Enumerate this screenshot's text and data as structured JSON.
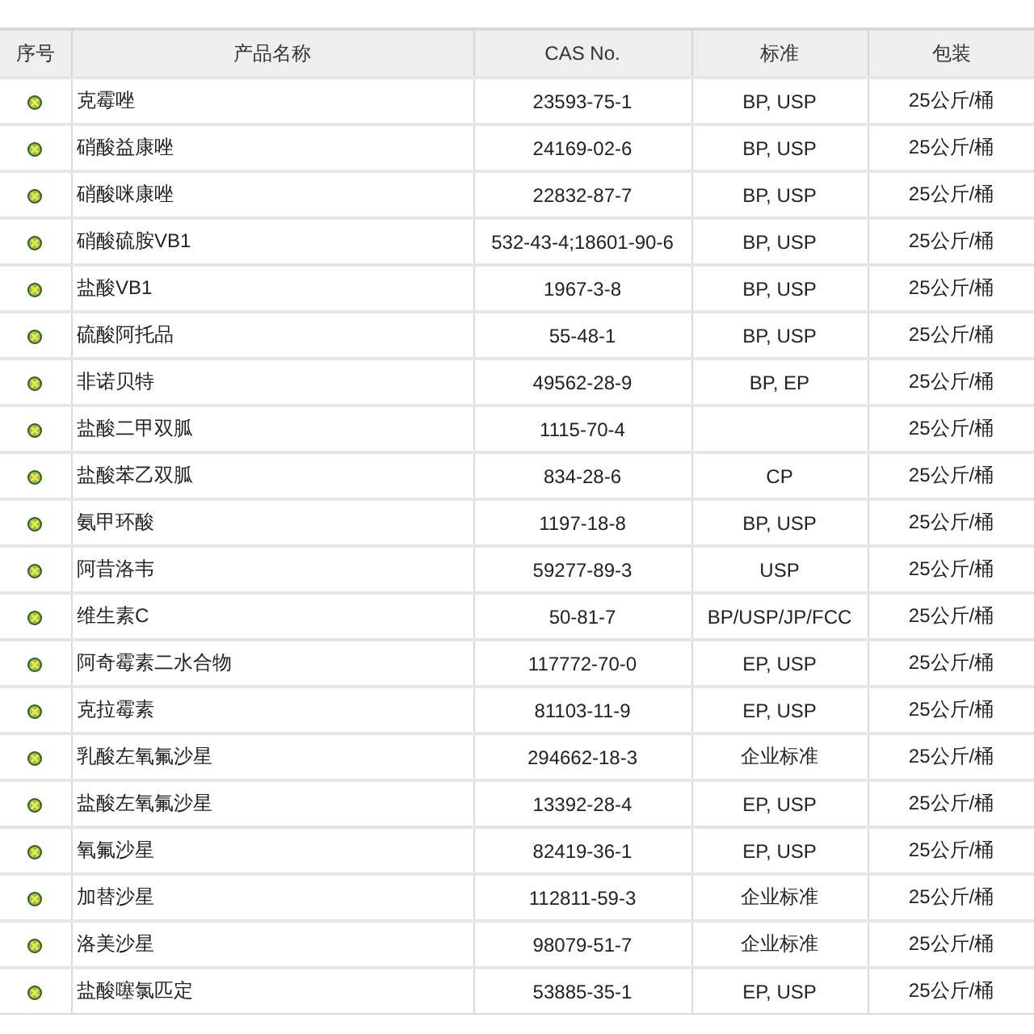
{
  "table": {
    "columns": [
      "序号",
      "产品名称",
      "CAS No.",
      "标准",
      "包装"
    ],
    "rows": [
      {
        "name": "克霉唑",
        "cas": "23593-75-1",
        "standard": "BP, USP",
        "packing": "25公斤/桶"
      },
      {
        "name": "硝酸益康唑",
        "cas": "24169-02-6",
        "standard": "BP, USP",
        "packing": "25公斤/桶"
      },
      {
        "name": "硝酸咪康唑",
        "cas": "22832-87-7",
        "standard": "BP, USP",
        "packing": "25公斤/桶"
      },
      {
        "name": "硝酸硫胺VB1",
        "cas": "532-43-4;18601-90-6",
        "standard": "BP, USP",
        "packing": "25公斤/桶"
      },
      {
        "name": "盐酸VB1",
        "cas": "1967-3-8",
        "standard": "BP, USP",
        "packing": "25公斤/桶"
      },
      {
        "name": "硫酸阿托品",
        "cas": "55-48-1",
        "standard": "BP, USP",
        "packing": "25公斤/桶"
      },
      {
        "name": "非诺贝特",
        "cas": "49562-28-9",
        "standard": "BP, EP",
        "packing": "25公斤/桶"
      },
      {
        "name": "盐酸二甲双胍",
        "cas": "1115-70-4",
        "packing": "25公斤/桶"
      },
      {
        "name": "盐酸苯乙双胍",
        "cas": "834-28-6",
        "standard": "CP",
        "packing": "25公斤/桶"
      },
      {
        "name": "氨甲环酸",
        "cas": "1197-18-8",
        "standard": "BP, USP",
        "packing": "25公斤/桶"
      },
      {
        "name": "阿昔洛韦",
        "cas": "59277-89-3",
        "standard": "USP",
        "packing": "25公斤/桶"
      },
      {
        "name": "维生素C",
        "cas": "50-81-7",
        "standard": "BP/USP/JP/FCC",
        "packing": "25公斤/桶"
      },
      {
        "name": "阿奇霉素二水合物",
        "cas": "117772-70-0",
        "standard": "EP, USP",
        "packing": "25公斤/桶"
      },
      {
        "name": "克拉霉素",
        "cas": "81103-11-9",
        "standard": "EP, USP",
        "packing": "25公斤/桶"
      },
      {
        "name": "乳酸左氧氟沙星",
        "cas": "294662-18-3",
        "standard": "企业标准",
        "packing": "25公斤/桶"
      },
      {
        "name": "盐酸左氧氟沙星",
        "cas": "13392-28-4",
        "standard": "EP, USP",
        "packing": "25公斤/桶"
      },
      {
        "name": "氧氟沙星",
        "cas": "82419-36-1",
        "standard": "EP, USP",
        "packing": "25公斤/桶"
      },
      {
        "name": "加替沙星",
        "cas": "112811-59-3",
        "standard": "企业标准",
        "packing": "25公斤/桶"
      },
      {
        "name": "洛美沙星",
        "cas": "98079-51-7",
        "standard": "企业标准",
        "packing": "25公斤/桶"
      },
      {
        "name": "盐酸噻氯匹定",
        "cas": "53885-35-1",
        "standard": "EP, USP",
        "packing": "25公斤/桶"
      }
    ]
  }
}
